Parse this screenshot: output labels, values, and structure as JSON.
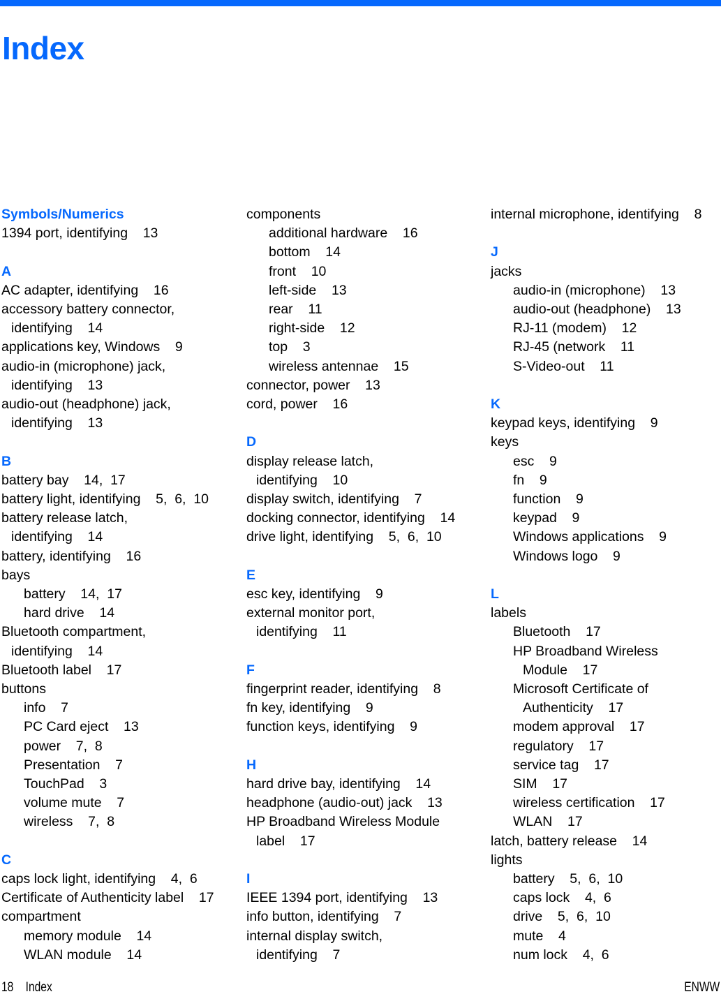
{
  "document": {
    "title": "Index",
    "title_color": "#0568fd",
    "rule_color": "#0568fd"
  },
  "footer": {
    "page_number": "18",
    "section_label": "Index",
    "left_text": "18    Index",
    "right_text": "ENWW"
  },
  "index": {
    "columns": [
      {
        "id": "column-1",
        "lines": [
          {
            "type": "letter",
            "text": "Symbols/Numerics"
          },
          {
            "type": "lvl0",
            "text": "1394 port, identifying    13"
          },
          {
            "type": "spacer",
            "text": ""
          },
          {
            "type": "letter",
            "text": "A"
          },
          {
            "type": "lvl0",
            "text": "AC adapter, identifying    16"
          },
          {
            "type": "lvl0",
            "text": "accessory battery connector,"
          },
          {
            "type": "cont0",
            "text": "identifying    14"
          },
          {
            "type": "lvl0",
            "text": "applications key, Windows    9"
          },
          {
            "type": "lvl0",
            "text": "audio-in (microphone) jack,"
          },
          {
            "type": "cont0",
            "text": "identifying    13"
          },
          {
            "type": "lvl0",
            "text": "audio-out (headphone) jack,"
          },
          {
            "type": "cont0",
            "text": "identifying    13"
          },
          {
            "type": "spacer",
            "text": ""
          },
          {
            "type": "letter",
            "text": "B"
          },
          {
            "type": "lvl0",
            "text": "battery bay    14,  17"
          },
          {
            "type": "lvl0",
            "text": "battery light, identifying    5,  6,  10"
          },
          {
            "type": "lvl0",
            "text": "battery release latch,"
          },
          {
            "type": "cont0",
            "text": "identifying    14"
          },
          {
            "type": "lvl0",
            "text": "battery, identifying    16"
          },
          {
            "type": "lvl0",
            "text": "bays"
          },
          {
            "type": "lvl1",
            "text": "battery    14,  17"
          },
          {
            "type": "lvl1",
            "text": "hard drive    14"
          },
          {
            "type": "lvl0",
            "text": "Bluetooth compartment,"
          },
          {
            "type": "cont0",
            "text": "identifying    14"
          },
          {
            "type": "lvl0",
            "text": "Bluetooth label    17"
          },
          {
            "type": "lvl0",
            "text": "buttons"
          },
          {
            "type": "lvl1",
            "text": "info    7"
          },
          {
            "type": "lvl1",
            "text": "PC Card eject    13"
          },
          {
            "type": "lvl1",
            "text": "power    7,  8"
          },
          {
            "type": "lvl1",
            "text": "Presentation    7"
          },
          {
            "type": "lvl1",
            "text": "TouchPad    3"
          },
          {
            "type": "lvl1",
            "text": "volume mute    7"
          },
          {
            "type": "lvl1",
            "text": "wireless    7,  8"
          },
          {
            "type": "spacer",
            "text": ""
          },
          {
            "type": "letter",
            "text": "C"
          },
          {
            "type": "lvl0",
            "text": "caps lock light, identifying    4,  6"
          },
          {
            "type": "lvl0",
            "text": "Certificate of Authenticity label    17"
          },
          {
            "type": "lvl0",
            "text": "compartment"
          },
          {
            "type": "lvl1",
            "text": "memory module    14"
          },
          {
            "type": "lvl1",
            "text": "WLAN module    14"
          }
        ]
      },
      {
        "id": "column-2",
        "lines": [
          {
            "type": "lvl0",
            "text": "components"
          },
          {
            "type": "lvl1",
            "text": "additional hardware    16"
          },
          {
            "type": "lvl1",
            "text": "bottom    14"
          },
          {
            "type": "lvl1",
            "text": "front    10"
          },
          {
            "type": "lvl1",
            "text": "left-side    13"
          },
          {
            "type": "lvl1",
            "text": "rear    11"
          },
          {
            "type": "lvl1",
            "text": "right-side    12"
          },
          {
            "type": "lvl1",
            "text": "top    3"
          },
          {
            "type": "lvl1",
            "text": "wireless antennae    15"
          },
          {
            "type": "lvl0",
            "text": "connector, power    13"
          },
          {
            "type": "lvl0",
            "text": "cord, power    16"
          },
          {
            "type": "spacer",
            "text": ""
          },
          {
            "type": "letter",
            "text": "D"
          },
          {
            "type": "lvl0",
            "text": "display release latch,"
          },
          {
            "type": "cont0",
            "text": "identifying    10"
          },
          {
            "type": "lvl0",
            "text": "display switch, identifying    7"
          },
          {
            "type": "lvl0",
            "text": "docking connector, identifying    14"
          },
          {
            "type": "lvl0",
            "text": "drive light, identifying    5,  6,  10"
          },
          {
            "type": "spacer",
            "text": ""
          },
          {
            "type": "letter",
            "text": "E"
          },
          {
            "type": "lvl0",
            "text": "esc key, identifying    9"
          },
          {
            "type": "lvl0",
            "text": "external monitor port,"
          },
          {
            "type": "cont0",
            "text": "identifying    11"
          },
          {
            "type": "spacer",
            "text": ""
          },
          {
            "type": "letter",
            "text": "F"
          },
          {
            "type": "lvl0",
            "text": "fingerprint reader, identifying    8"
          },
          {
            "type": "lvl0",
            "text": "fn key, identifying    9"
          },
          {
            "type": "lvl0",
            "text": "function keys, identifying    9"
          },
          {
            "type": "spacer",
            "text": ""
          },
          {
            "type": "letter",
            "text": "H"
          },
          {
            "type": "lvl0",
            "text": "hard drive bay, identifying    14"
          },
          {
            "type": "lvl0",
            "text": "headphone (audio-out) jack    13"
          },
          {
            "type": "lvl0",
            "text": "HP Broadband Wireless Module"
          },
          {
            "type": "cont0",
            "text": "label    17"
          },
          {
            "type": "spacer",
            "text": ""
          },
          {
            "type": "letter",
            "text": "I"
          },
          {
            "type": "lvl0",
            "text": "IEEE 1394 port, identifying    13"
          },
          {
            "type": "lvl0",
            "text": "info button, identifying    7"
          },
          {
            "type": "lvl0",
            "text": "internal display switch,"
          },
          {
            "type": "cont0",
            "text": "identifying    7"
          }
        ]
      },
      {
        "id": "column-3",
        "lines": [
          {
            "type": "lvl0",
            "text": "internal microphone, identifying    8"
          },
          {
            "type": "spacer",
            "text": ""
          },
          {
            "type": "letter",
            "text": "J"
          },
          {
            "type": "lvl0",
            "text": "jacks"
          },
          {
            "type": "lvl1",
            "text": "audio-in (microphone)    13"
          },
          {
            "type": "lvl1",
            "text": "audio-out (headphone)    13"
          },
          {
            "type": "lvl1",
            "text": "RJ-11 (modem)    12"
          },
          {
            "type": "lvl1",
            "text": "RJ-45 (network    11"
          },
          {
            "type": "lvl1",
            "text": "S-Video-out    11"
          },
          {
            "type": "spacer",
            "text": ""
          },
          {
            "type": "letter",
            "text": "K"
          },
          {
            "type": "lvl0",
            "text": "keypad keys, identifying    9"
          },
          {
            "type": "lvl0",
            "text": "keys"
          },
          {
            "type": "lvl1",
            "text": "esc    9"
          },
          {
            "type": "lvl1",
            "text": "fn    9"
          },
          {
            "type": "lvl1",
            "text": "function    9"
          },
          {
            "type": "lvl1",
            "text": "keypad    9"
          },
          {
            "type": "lvl1",
            "text": "Windows applications    9"
          },
          {
            "type": "lvl1",
            "text": "Windows logo    9"
          },
          {
            "type": "spacer",
            "text": ""
          },
          {
            "type": "letter",
            "text": "L"
          },
          {
            "type": "lvl0",
            "text": "labels"
          },
          {
            "type": "lvl1",
            "text": "Bluetooth    17"
          },
          {
            "type": "lvl1",
            "text": "HP Broadband Wireless"
          },
          {
            "type": "cont1",
            "text": "Module    17"
          },
          {
            "type": "lvl1",
            "text": "Microsoft Certificate of"
          },
          {
            "type": "cont1",
            "text": "Authenticity    17"
          },
          {
            "type": "lvl1",
            "text": "modem approval    17"
          },
          {
            "type": "lvl1",
            "text": "regulatory    17"
          },
          {
            "type": "lvl1",
            "text": "service tag    17"
          },
          {
            "type": "lvl1",
            "text": "SIM    17"
          },
          {
            "type": "lvl1",
            "text": "wireless certification    17"
          },
          {
            "type": "lvl1",
            "text": "WLAN    17"
          },
          {
            "type": "lvl0",
            "text": "latch, battery release    14"
          },
          {
            "type": "lvl0",
            "text": "lights"
          },
          {
            "type": "lvl1",
            "text": "battery    5,  6,  10"
          },
          {
            "type": "lvl1",
            "text": "caps lock    4,  6"
          },
          {
            "type": "lvl1",
            "text": "drive    5,  6,  10"
          },
          {
            "type": "lvl1",
            "text": "mute    4"
          },
          {
            "type": "lvl1",
            "text": "num lock    4,  6"
          }
        ]
      }
    ]
  }
}
